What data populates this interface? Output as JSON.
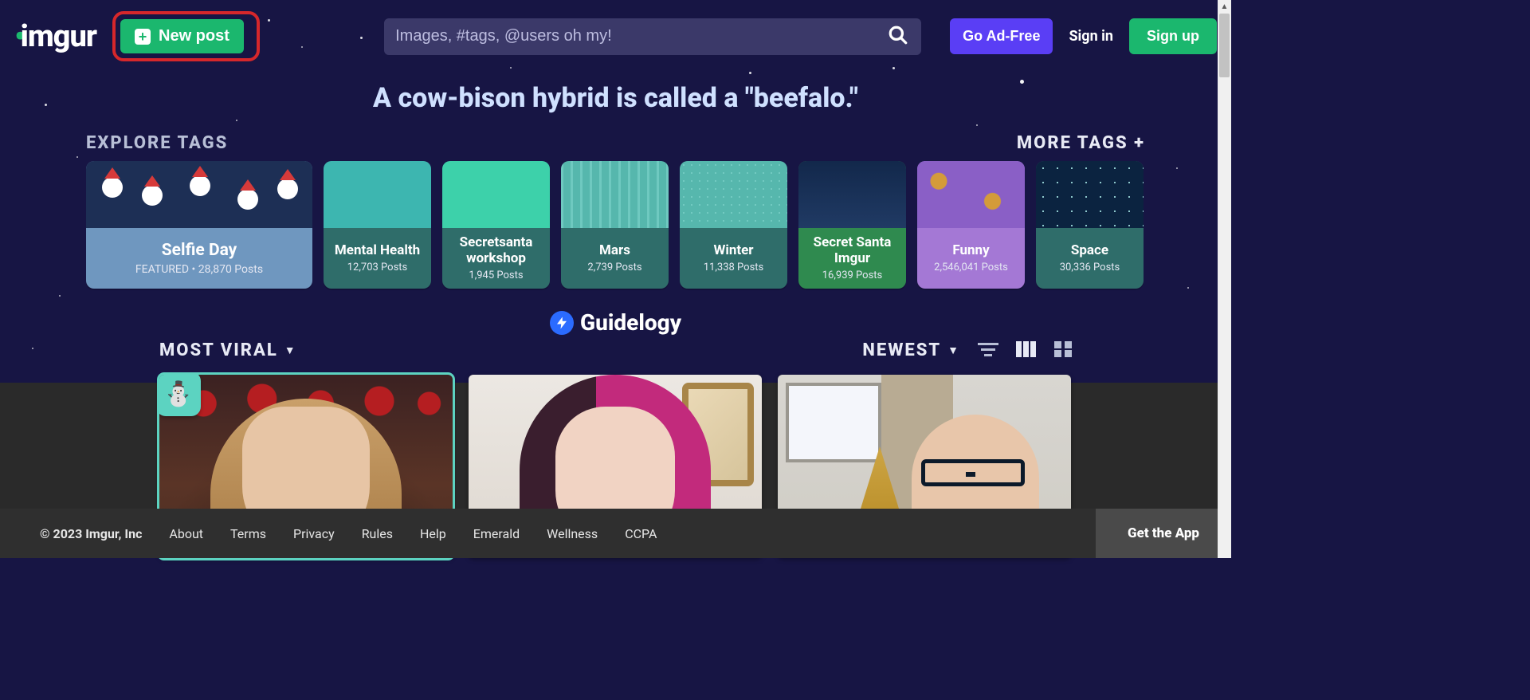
{
  "header": {
    "logo_text": "imgur",
    "new_post_label": "New post",
    "search_placeholder": "Images, #tags, @users oh my!",
    "adfree_label": "Go Ad-Free",
    "signin_label": "Sign in",
    "signup_label": "Sign up"
  },
  "fact_text": "A cow-bison hybrid is called a \"beefalo.\"",
  "explore": {
    "title": "EXPLORE TAGS",
    "more_label": "MORE TAGS +",
    "tags": [
      {
        "style": "feat bg-selfie",
        "name": "Selfie Day",
        "sub": "FEATURED • 28,870 Posts"
      },
      {
        "style": "small bg-mental",
        "name": "Mental Health",
        "sub": "12,703 Posts"
      },
      {
        "style": "small bg-secretws",
        "name": "Secretsanta workshop",
        "sub": "1,945 Posts"
      },
      {
        "style": "small bg-mars",
        "name": "Mars",
        "sub": "2,739 Posts"
      },
      {
        "style": "small bg-winter",
        "name": "Winter",
        "sub": "11,338 Posts"
      },
      {
        "style": "small bg-santa",
        "name": "Secret Santa Imgur",
        "sub": "16,939 Posts"
      },
      {
        "style": "small bg-funny",
        "name": "Funny",
        "sub": "2,546,041 Posts"
      },
      {
        "style": "small bg-space",
        "name": "Space",
        "sub": "30,336 Posts"
      }
    ]
  },
  "watermark": {
    "text": "Guidelogy"
  },
  "feed": {
    "left_sort": "MOST VIRAL",
    "right_sort": "NEWEST"
  },
  "footer": {
    "copyright": "© 2023 Imgur, Inc",
    "links": [
      "About",
      "Terms",
      "Privacy",
      "Rules",
      "Help",
      "Emerald",
      "Wellness",
      "CCPA"
    ],
    "getapp": "Get the App"
  }
}
